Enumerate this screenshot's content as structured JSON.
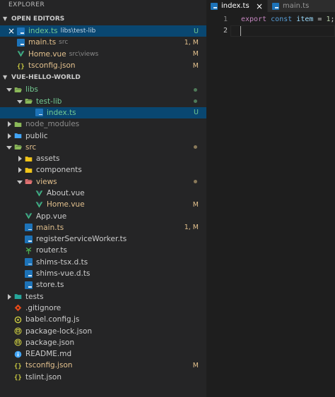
{
  "sidebar": {
    "title": "EXPLORER",
    "open_editors": {
      "header": "OPEN EDITORS",
      "items": [
        {
          "name": "index.ts",
          "desc": "libs\\test-lib",
          "badge": "U",
          "icon": "typescript-file-icon",
          "color": "#73c991"
        },
        {
          "name": "main.ts",
          "desc": "src",
          "badge": "1, M",
          "icon": "typescript-file-icon",
          "color": "#e2c08d"
        },
        {
          "name": "Home.vue",
          "desc": "src\\views",
          "badge": "M",
          "icon": "vue-file-icon",
          "color": "#e2c08d"
        },
        {
          "name": "tsconfig.json",
          "desc": "",
          "badge": "M",
          "icon": "json-file-icon",
          "color": "#e2c08d"
        }
      ]
    },
    "project": {
      "header": "VUE-HELLO-WORLD",
      "tree": [
        {
          "name": "libs",
          "type": "folder",
          "expanded": true,
          "depth": 0,
          "color": "#73c991",
          "marker": "dot"
        },
        {
          "name": "test-lib",
          "type": "folder",
          "expanded": true,
          "depth": 1,
          "color": "#73c991",
          "marker": "dot"
        },
        {
          "name": "index.ts",
          "type": "ts",
          "depth": 2,
          "color": "#73c991",
          "badge": "U",
          "selected": true
        },
        {
          "name": "node_modules",
          "type": "folder",
          "expanded": false,
          "depth": 0,
          "color": "#8c8c8c"
        },
        {
          "name": "public",
          "type": "folder-blue",
          "expanded": false,
          "depth": 0,
          "color": "#cccccc"
        },
        {
          "name": "src",
          "type": "folder",
          "expanded": true,
          "depth": 0,
          "color": "#e2c08d",
          "marker": "dot"
        },
        {
          "name": "assets",
          "type": "folder-yellow",
          "expanded": false,
          "depth": 1,
          "color": "#cccccc"
        },
        {
          "name": "components",
          "type": "folder-yellow",
          "expanded": false,
          "depth": 1,
          "color": "#cccccc"
        },
        {
          "name": "views",
          "type": "folder-red",
          "expanded": true,
          "depth": 1,
          "color": "#e2c08d",
          "marker": "dot"
        },
        {
          "name": "About.vue",
          "type": "vue",
          "depth": 2,
          "color": "#cccccc"
        },
        {
          "name": "Home.vue",
          "type": "vue",
          "depth": 2,
          "color": "#e2c08d",
          "badge": "M"
        },
        {
          "name": "App.vue",
          "type": "vue",
          "depth": 1,
          "color": "#cccccc"
        },
        {
          "name": "main.ts",
          "type": "ts",
          "depth": 1,
          "color": "#e2c08d",
          "badge": "1, M"
        },
        {
          "name": "registerServiceWorker.ts",
          "type": "ts",
          "depth": 1,
          "color": "#cccccc"
        },
        {
          "name": "router.ts",
          "type": "router",
          "depth": 1,
          "color": "#cccccc"
        },
        {
          "name": "shims-tsx.d.ts",
          "type": "ts",
          "depth": 1,
          "color": "#cccccc"
        },
        {
          "name": "shims-vue.d.ts",
          "type": "ts",
          "depth": 1,
          "color": "#cccccc"
        },
        {
          "name": "store.ts",
          "type": "ts",
          "depth": 1,
          "color": "#cccccc"
        },
        {
          "name": "tests",
          "type": "folder-teal",
          "expanded": false,
          "depth": 0,
          "color": "#cccccc"
        },
        {
          "name": ".gitignore",
          "type": "git",
          "depth": 0,
          "color": "#cccccc"
        },
        {
          "name": "babel.config.js",
          "type": "js",
          "depth": 0,
          "color": "#cccccc"
        },
        {
          "name": "package-lock.json",
          "type": "npm",
          "depth": 0,
          "color": "#cccccc"
        },
        {
          "name": "package.json",
          "type": "npm",
          "depth": 0,
          "color": "#cccccc"
        },
        {
          "name": "README.md",
          "type": "info",
          "depth": 0,
          "color": "#cccccc"
        },
        {
          "name": "tsconfig.json",
          "type": "json",
          "depth": 0,
          "color": "#e2c08d",
          "badge": "M"
        },
        {
          "name": "tslint.json",
          "type": "json",
          "depth": 0,
          "color": "#cccccc"
        }
      ]
    }
  },
  "editor": {
    "tabs": [
      {
        "label": "index.ts",
        "active": true,
        "close": "×"
      },
      {
        "label": "main.ts",
        "active": false
      }
    ],
    "lines": [
      {
        "number": "1",
        "tokens": [
          {
            "t": "export",
            "c": "kw"
          },
          {
            "t": " ",
            "c": "op"
          },
          {
            "t": "const",
            "c": "kw2"
          },
          {
            "t": " ",
            "c": "op"
          },
          {
            "t": "item",
            "c": "var"
          },
          {
            "t": " = ",
            "c": "op"
          },
          {
            "t": "1",
            "c": "num"
          },
          {
            "t": ";",
            "c": "op"
          }
        ]
      },
      {
        "number": "2",
        "tokens": [],
        "cursor": true
      }
    ]
  },
  "close_glyph": "×"
}
